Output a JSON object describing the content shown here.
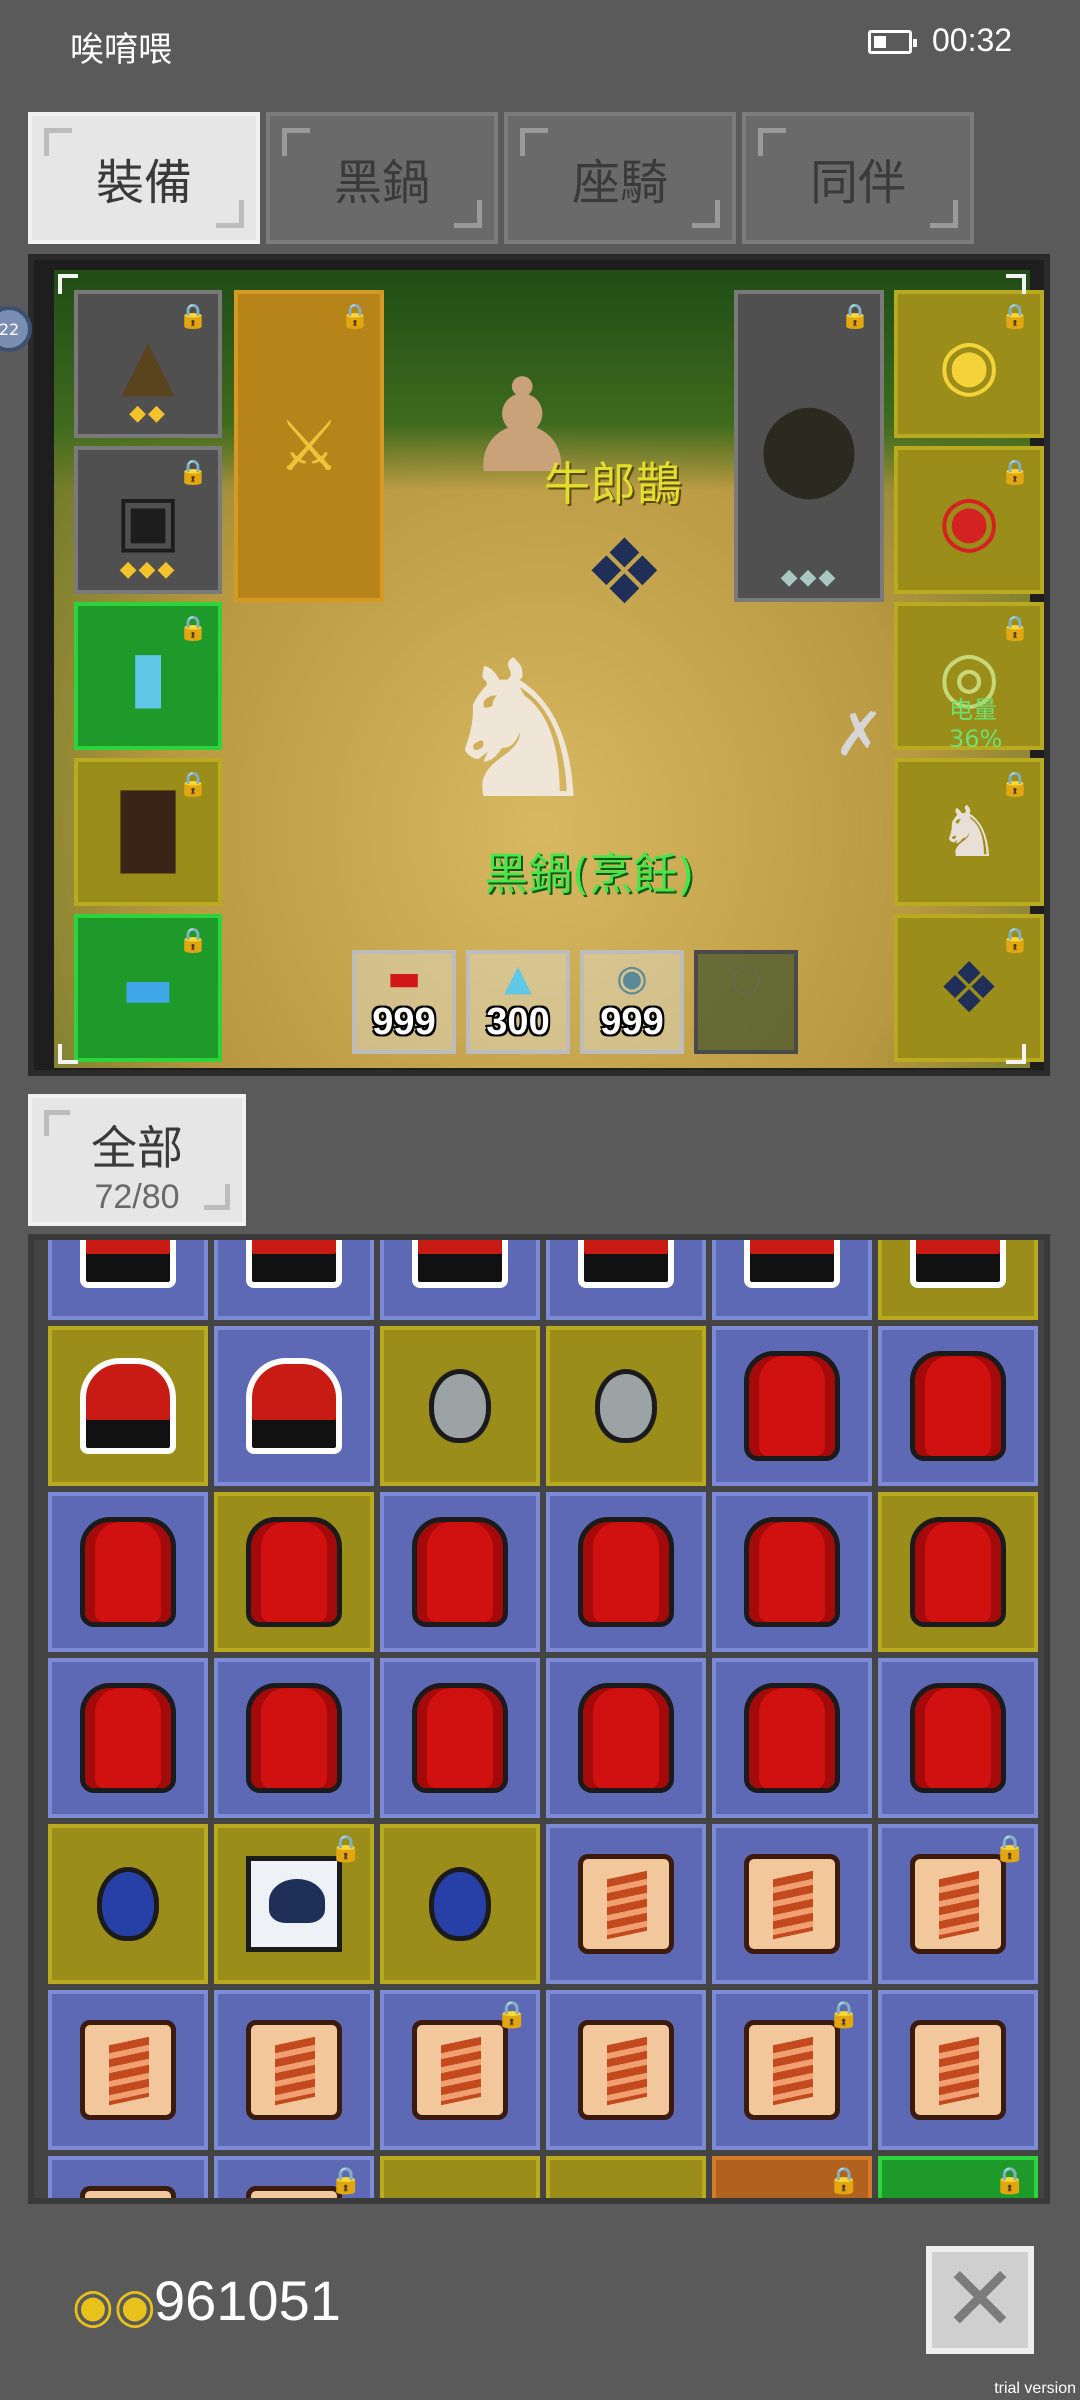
{
  "status_bar": {
    "app_name": "唉唷喂",
    "time": "00:32",
    "battery_icon": "battery-icon"
  },
  "tabs": [
    {
      "label": "裝備",
      "active": true
    },
    {
      "label": "黑鍋",
      "active": false
    },
    {
      "label": "座騎",
      "active": false
    },
    {
      "label": "同伴",
      "active": false
    }
  ],
  "equipment": {
    "pet_name": "牛郎鵲",
    "mount_name": "黑鍋(烹飪)",
    "battery_overlay": "电量36%",
    "side_tab": "22",
    "hotbar": [
      {
        "item": "red-pepper",
        "count": "999"
      },
      {
        "item": "blue-potion",
        "count": "300"
      },
      {
        "item": "teapot",
        "count": "999"
      },
      {
        "item": "empty",
        "count": ""
      }
    ]
  },
  "inventory": {
    "filter_label": "全部",
    "filter_count": "72/80",
    "colors": {
      "blue": "#5d69b4",
      "olive": "#9a8d1a",
      "green": "#1d9a2a",
      "orange": "#b0621e"
    }
  },
  "bottom": {
    "gold_amount": "961051",
    "gold_icon": "gold-coins-icon",
    "close_icon": "close-icon",
    "watermark": "trial version"
  }
}
